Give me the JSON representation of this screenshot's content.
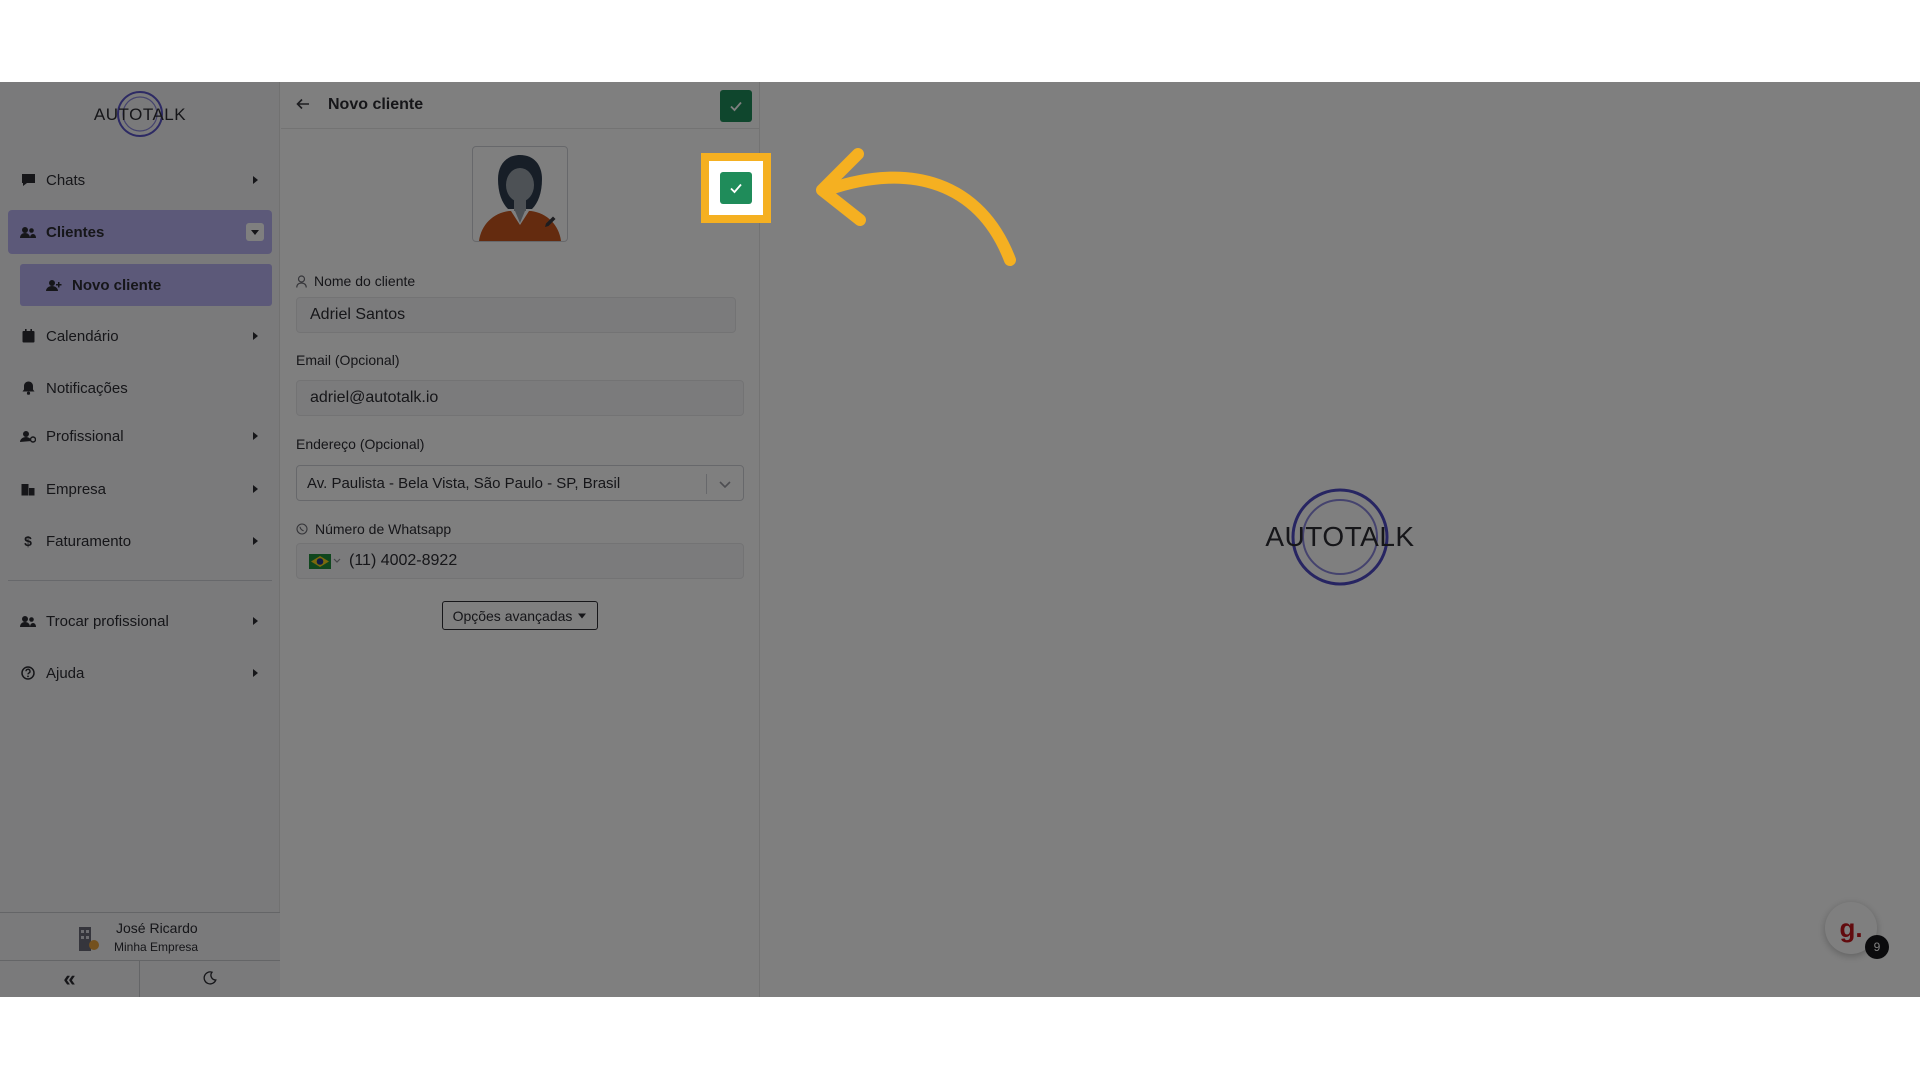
{
  "brand": {
    "name": "AUTOTALK"
  },
  "sidebar": {
    "items": [
      {
        "label": "Chats",
        "icon": "chat-icon"
      },
      {
        "label": "Clientes",
        "icon": "users-icon"
      },
      {
        "label": "Calendário",
        "icon": "calendar-icon"
      },
      {
        "label": "Notificações",
        "icon": "bell-icon"
      },
      {
        "label": "Profissional",
        "icon": "user-gear-icon"
      },
      {
        "label": "Empresa",
        "icon": "building-icon"
      },
      {
        "label": "Faturamento",
        "icon": "dollar-icon"
      },
      {
        "label": "Trocar profissional",
        "icon": "users-swap-icon"
      },
      {
        "label": "Ajuda",
        "icon": "help-icon"
      }
    ],
    "sub_item": {
      "label": "Novo cliente",
      "icon": "user-plus-icon"
    },
    "profile": {
      "name": "José Ricardo",
      "company": "Minha Empresa"
    },
    "collapse_label": "«"
  },
  "form": {
    "title": "Novo cliente",
    "name_label": "Nome do cliente",
    "name_value": "Adriel Santos",
    "email_label": "Email (Opcional)",
    "email_value": "adriel@autotalk.io",
    "address_label": "Endereço (Opcional)",
    "address_value": "Av. Paulista - Bela Vista, São Paulo - SP, Brasil",
    "whatsapp_label": "Número de Whatsapp",
    "whatsapp_value": "(11) 4002-8922",
    "advanced_label": "Opções avançadas"
  },
  "main": {
    "logo_text": "AUTOTALK"
  },
  "chat_widget": {
    "letter": "g.",
    "badge_count": "9"
  },
  "colors": {
    "accent": "#b9b3f2",
    "save": "#1f8c5a",
    "highlight": "#f5b021",
    "overlay": "rgba(0,0,0,0.5)"
  }
}
